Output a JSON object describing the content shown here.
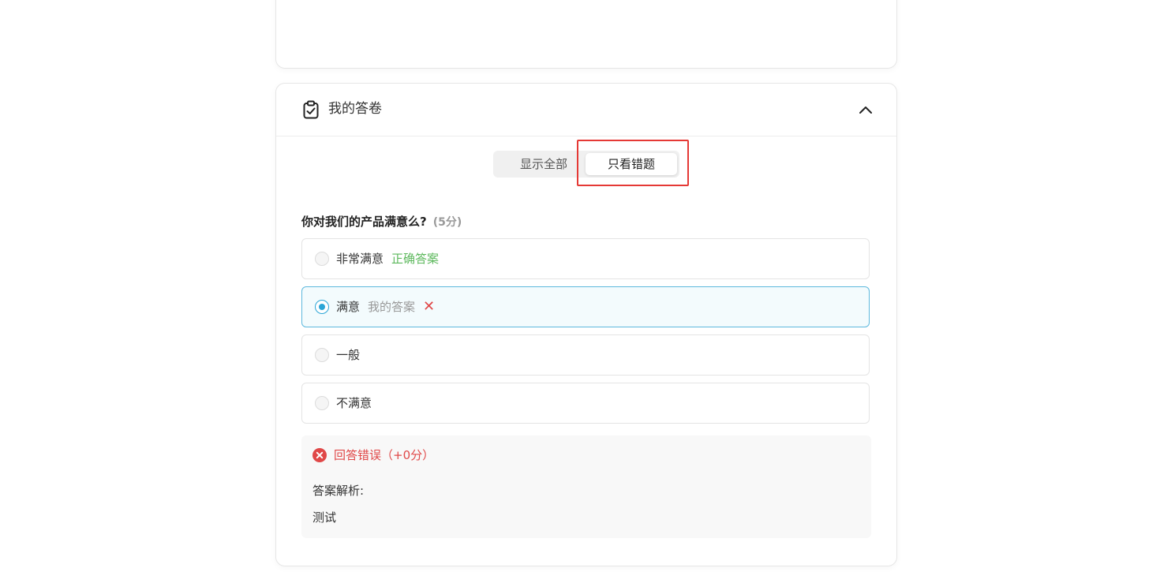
{
  "section": {
    "title": "我的答卷",
    "icon": "clipboard-check-icon",
    "collapse_icon": "chevron-up-icon"
  },
  "filter": {
    "show_all": "显示全部",
    "wrong_only": "只看错题",
    "active": "wrong_only"
  },
  "question": {
    "text": "你对我们的产品满意么?",
    "score": "(5分)",
    "options": [
      {
        "label": "非常满意",
        "tag": "正确答案",
        "state": "correct-answer",
        "selected": false
      },
      {
        "label": "满意",
        "tag": "我的答案",
        "state": "my-answer-wrong",
        "selected": true
      },
      {
        "label": "一般",
        "tag": "",
        "state": "none",
        "selected": false
      },
      {
        "label": "不满意",
        "tag": "",
        "state": "none",
        "selected": false
      }
    ]
  },
  "feedback": {
    "result": "回答错误（+0分）",
    "analysis_label": "答案解析:",
    "analysis_text": "测试"
  },
  "colors": {
    "accent_blue": "#2ba5d6",
    "correct_green": "#5cb85c",
    "error_red": "#e04848",
    "highlight_red": "#e53935"
  }
}
